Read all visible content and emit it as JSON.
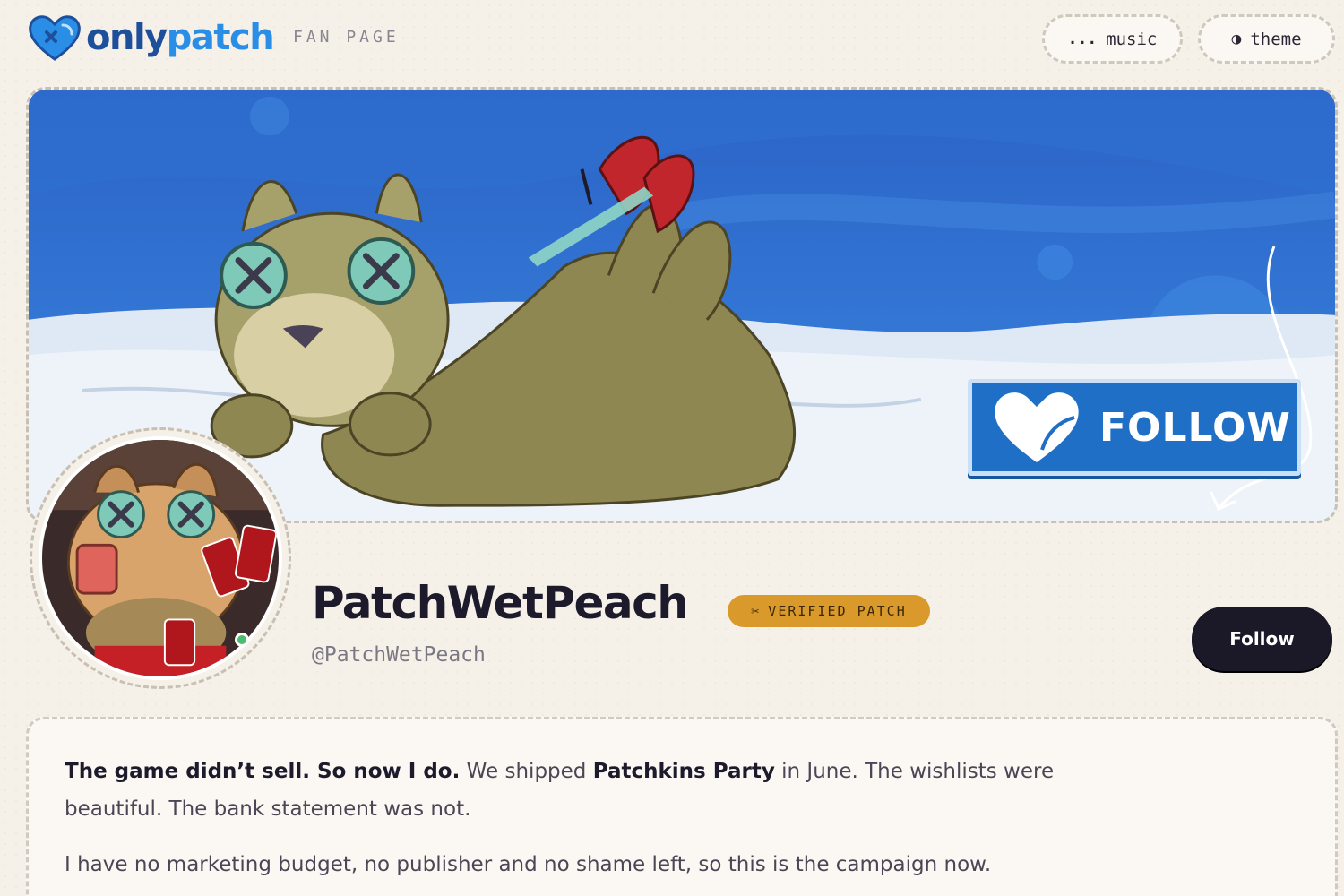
{
  "header": {
    "logo_part1": "only",
    "logo_part2": "patch",
    "tagline": "FAN PAGE",
    "music_icon": "...",
    "music_label": "music",
    "theme_icon": "◑",
    "theme_label": "theme"
  },
  "banner": {
    "follow_label": "FOLLOW"
  },
  "profile": {
    "display_name": "PatchWetPeach",
    "badge_icon": "✂",
    "badge_label": "VERIFIED PATCH",
    "handle": "@PatchWetPeach",
    "follow_label": "Follow"
  },
  "bio": {
    "p1_bold": "The game didn’t sell. So now I do.",
    "p1_text1": " We shipped ",
    "p1_game": "Patchkins Party",
    "p1_text2": " in June. The wishlists were beautiful. The bank statement was not.",
    "p2_text": "I have no marketing budget, no publisher and no shame left, so this is the campaign now."
  },
  "colors": {
    "accent_blue": "#2b8ee6",
    "brand_navy": "#1e4f9b",
    "badge_gold": "#d99a2b",
    "button_dark": "#1b1827",
    "page_bg": "#f5f1e9"
  },
  "icons": [
    "heart-logo-icon",
    "music-dots-icon",
    "theme-half-circle-icon",
    "scissors-icon",
    "heart-follow-icon",
    "arrow-down-icon"
  ]
}
